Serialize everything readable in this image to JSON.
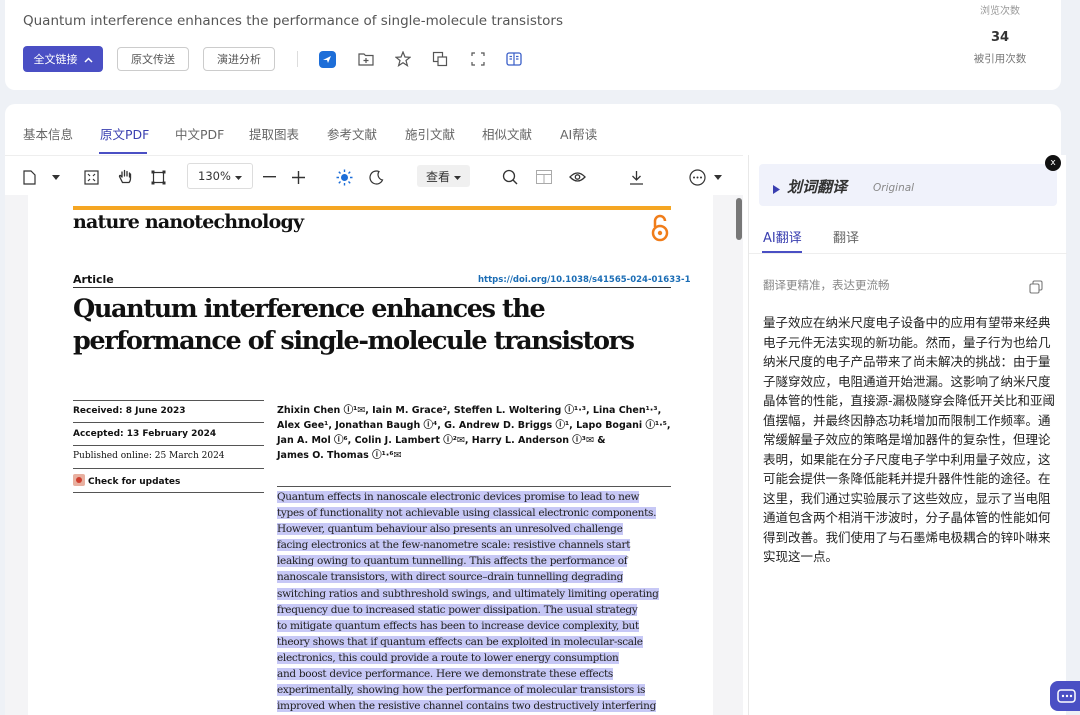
{
  "header": {
    "title": "Quantum interference enhances the performance of single-molecule transistors",
    "fulltext_btn": "全文链接",
    "delivery_btn": "原文传送",
    "evolution_btn": "演进分析",
    "views_label": "浏览次数",
    "cited_count": "34",
    "cited_label": "被引用次数"
  },
  "tabs": [
    "基本信息",
    "原文PDF",
    "中文PDF",
    "提取图表",
    "参考文献",
    "施引文献",
    "相似文献",
    "AI帮读"
  ],
  "toolbar": {
    "zoom": "130%",
    "view_label": "查看"
  },
  "pdf": {
    "journal": "nature nanotechnology",
    "article_label": "Article",
    "doi": "https://doi.org/10.1038/s41565-024-01633-1",
    "title": "Quantum interference enhances the performance of single-molecule transistors",
    "received": "Received: 8 June 2023",
    "accepted": "Accepted: 13 February 2024",
    "published": "Published online: 25 March 2024",
    "check_updates": "Check for updates",
    "authors": [
      "Zhixin Chen ⓘ¹✉, Iain M. Grace², Steffen L. Woltering ⓘ¹·³, Lina Chen¹·³,",
      "Alex Gee¹, Jonathan Baugh ⓘ⁴, G. Andrew D. Briggs ⓘ¹, Lapo Bogani ⓘ¹·⁵,",
      "Jan A. Mol ⓘ⁶, Colin J. Lambert ⓘ²✉, Harry L. Anderson ⓘ³✉ &",
      "James O. Thomas ⓘ¹·⁶✉"
    ],
    "abstract_lines": [
      "Quantum effects in nanoscale electronic devices promise to lead to new",
      "types of functionality not achievable using classical electronic components.",
      "However, quantum behaviour also presents an unresolved challenge",
      "facing electronics at the few-nanometre scale: resistive channels start",
      "leaking owing to quantum tunnelling. This affects the performance of",
      "nanoscale transistors, with direct source–drain tunnelling degrading",
      "switching ratios and subthreshold swings, and ultimately limiting operating",
      "frequency due to increased static power dissipation. The usual strategy",
      "to mitigate quantum effects has been to increase device complexity, but",
      "theory shows that if quantum effects can be exploited in molecular-scale",
      "electronics, this could provide a route to lower energy consumption",
      "and boost device performance. Here we demonstrate these effects",
      "experimentally, showing how the performance of molecular transistors is",
      "improved when the resistive channel contains two destructively interfering"
    ]
  },
  "panel": {
    "title": "划词翻译",
    "subtitle": "Original",
    "tab_ai": "AI翻译",
    "tab_plain": "翻译",
    "hint": "翻译更精准，表达更流畅",
    "translation": "量子效应在纳米尺度电子设备中的应用有望带来经典电子元件无法实现的新功能。然而，量子行为也给几纳米尺度的电子产品带来了尚未解决的挑战：由于量子隧穿效应，电阻通道开始泄漏。这影响了纳米尺度晶体管的性能，直接源-漏极隧穿会降低开关比和亚阈值摆幅，并最终因静态功耗增加而限制工作频率。通常缓解量子效应的策略是增加器件的复杂性，但理论表明，如果能在分子尺度电子学中利用量子效应，这可能会提供一条降低能耗并提升器件性能的途径。在这里，我们通过实验展示了这些效应，显示了当电阻通道包含两个相消干涉波时，分子晶体管的性能如何得到改善。我们使用了与石墨烯电极耦合的锌卟啉来实现这一点。",
    "close": "x"
  }
}
